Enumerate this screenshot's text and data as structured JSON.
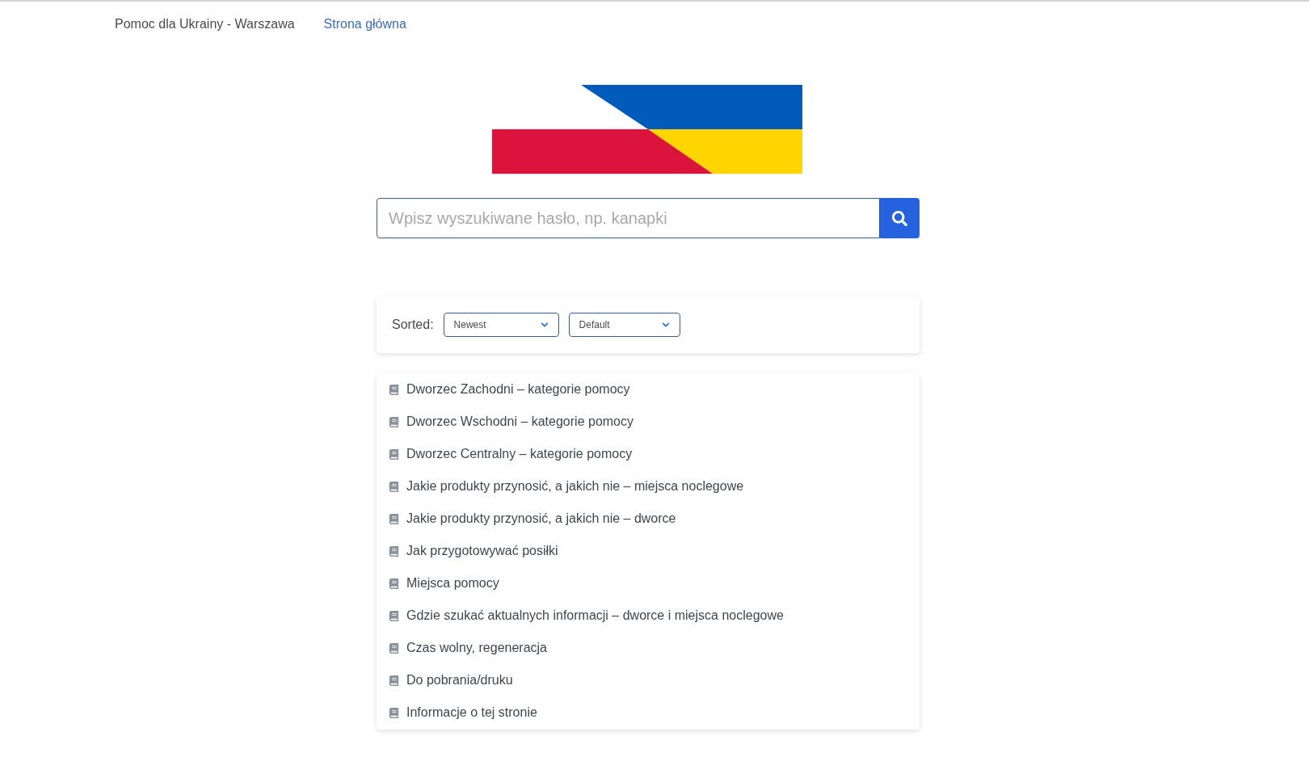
{
  "nav": {
    "brand": "Pomoc dla Ukrainy - Warszawa",
    "links": [
      "Strona główna"
    ]
  },
  "search": {
    "placeholder": "Wpisz wyszukiwane hasło, np. kanapki"
  },
  "sort": {
    "label": "Sorted:",
    "selects": [
      "Newest",
      "Default"
    ]
  },
  "articles": [
    "Dworzec Zachodni – kategorie pomocy",
    "Dworzec Wschodni – kategorie pomocy",
    "Dworzec Centralny – kategorie pomocy",
    "Jakie produkty przynosić, a jakich nie – miejsca noclegowe",
    "Jakie produkty przynosić, a jakich nie – dworce",
    "Jak przygotowywać posiłki",
    "Miejsca pomocy",
    "Gdzie szukać aktualnych informacji – dworce i miejsca noclegowe",
    "Czas wolny, regeneracja",
    "Do pobrania/druku",
    "Informacje o tej stronie"
  ]
}
